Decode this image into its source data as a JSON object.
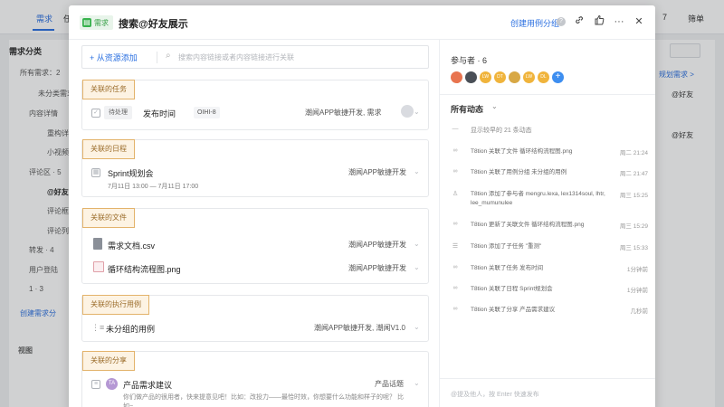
{
  "background": {
    "tabs": [
      {
        "label": "需求"
      },
      {
        "label": "任务"
      }
    ],
    "top_right": [
      "7",
      "筛单"
    ],
    "sidebar_title": "需求分类",
    "sidebar_items": [
      {
        "label": "所有需求：2",
        "style": ""
      },
      {
        "label": "未分类需求",
        "style": ""
      },
      {
        "label": "内容详情",
        "style": ""
      },
      {
        "label": "重构详",
        "style": ""
      },
      {
        "label": "小视频",
        "style": ""
      },
      {
        "label": "评论区 · 5",
        "style": ""
      },
      {
        "label": "@好友",
        "style": "bold"
      },
      {
        "label": "评论框",
        "style": ""
      },
      {
        "label": "评论列",
        "style": ""
      },
      {
        "label": "转发 · 4",
        "style": ""
      },
      {
        "label": "用户登陆",
        "style": ""
      },
      {
        "label": "1 · 3",
        "style": ""
      },
      {
        "label": "创建需求分",
        "style": "blue"
      }
    ],
    "sidebar_view_label": "视图",
    "right_cells": [
      "规划需求 >",
      "@好友",
      "@好友"
    ]
  },
  "modal": {
    "type_tag": "需求",
    "title": "搜索@好友展示",
    "create_link": "创建用例分组",
    "help": "?",
    "add_button": "+ 从资源添加",
    "search_placeholder": "搜索内容链接或者内容链接进行关联",
    "sections": {
      "tasks": {
        "tag": "关联的任务",
        "row": {
          "status": "待处理",
          "title": "发布时间",
          "id": "OIHI-8",
          "project": "潮闻APP敏捷开发, 需求"
        }
      },
      "schedule": {
        "tag": "关联的日程",
        "row": {
          "title": "Sprint规划会",
          "sub": "7月11日 13:00 — 7月11日 17:00",
          "project": "潮闻APP敏捷开发"
        }
      },
      "files": {
        "tag": "关联的文件",
        "rows": [
          {
            "title": "需求文档.csv",
            "project": "潮闻APP敏捷开发"
          },
          {
            "title": "循环结构流程图.png",
            "project": "潮闻APP敏捷开发"
          }
        ]
      },
      "testcases": {
        "tag": "关联的执行用例",
        "row": {
          "title": "未分组的用例",
          "project": "潮闻APP敏捷开发, 潮闻V1.0"
        }
      },
      "shares": {
        "tag": "关联的分享",
        "row": {
          "avatar": "TA",
          "title": "产品需求建议",
          "project": "产品话题",
          "sub": "你们做产品的很用者，快来提意见吧！比如：改投力——最恰时效，你想要什么功能和样子的呢？ 比如~"
        }
      }
    }
  },
  "activity": {
    "participants_label": "参与者 · 6",
    "participants": [
      {
        "initials": "",
        "color": "#e8744f"
      },
      {
        "initials": "",
        "color": "#4a4f57"
      },
      {
        "initials": "LW",
        "color": "#f0b43c"
      },
      {
        "initials": "DT",
        "color": "#f0b43c"
      },
      {
        "initials": "",
        "color": "#d8a845"
      },
      {
        "initials": "LW",
        "color": "#f0b43c"
      },
      {
        "initials": "DL",
        "color": "#f0b43c"
      }
    ],
    "add_participant": "+",
    "label": "所有动态",
    "more_text": "显示较早的 21 条动态",
    "items": [
      {
        "icon": "link",
        "text": "T8tion 关联了文件 循环结构流程图.png",
        "time": "周二 21:24"
      },
      {
        "icon": "link",
        "text": "T8tion 关联了用例分组 未分组的用例",
        "time": "周二 21:47"
      },
      {
        "icon": "user",
        "text": "T8tion 添加了参与者 mengru.lexa, lex1314soul, lhtr, lee_mumunulee",
        "time": "周三 15:25"
      },
      {
        "icon": "link",
        "text": "T8tion 更新了关联文件 循环结构流程图.png",
        "time": "周三 15:29"
      },
      {
        "icon": "list",
        "text": "T8tion 添加了子任务 \"重测\"",
        "time": "周三 15:33"
      },
      {
        "icon": "link",
        "text": "T8tion 关联了任务 发布时间",
        "time": "1分钟前"
      },
      {
        "icon": "link",
        "text": "T8tion 关联了日程 Sprint规划会",
        "time": "1分钟前"
      },
      {
        "icon": "link",
        "text": "T8tion 关联了分享 产品需求建议",
        "time": "几秒前"
      }
    ],
    "comment_placeholder": "@提及他人，按 Enter 快速发布"
  }
}
